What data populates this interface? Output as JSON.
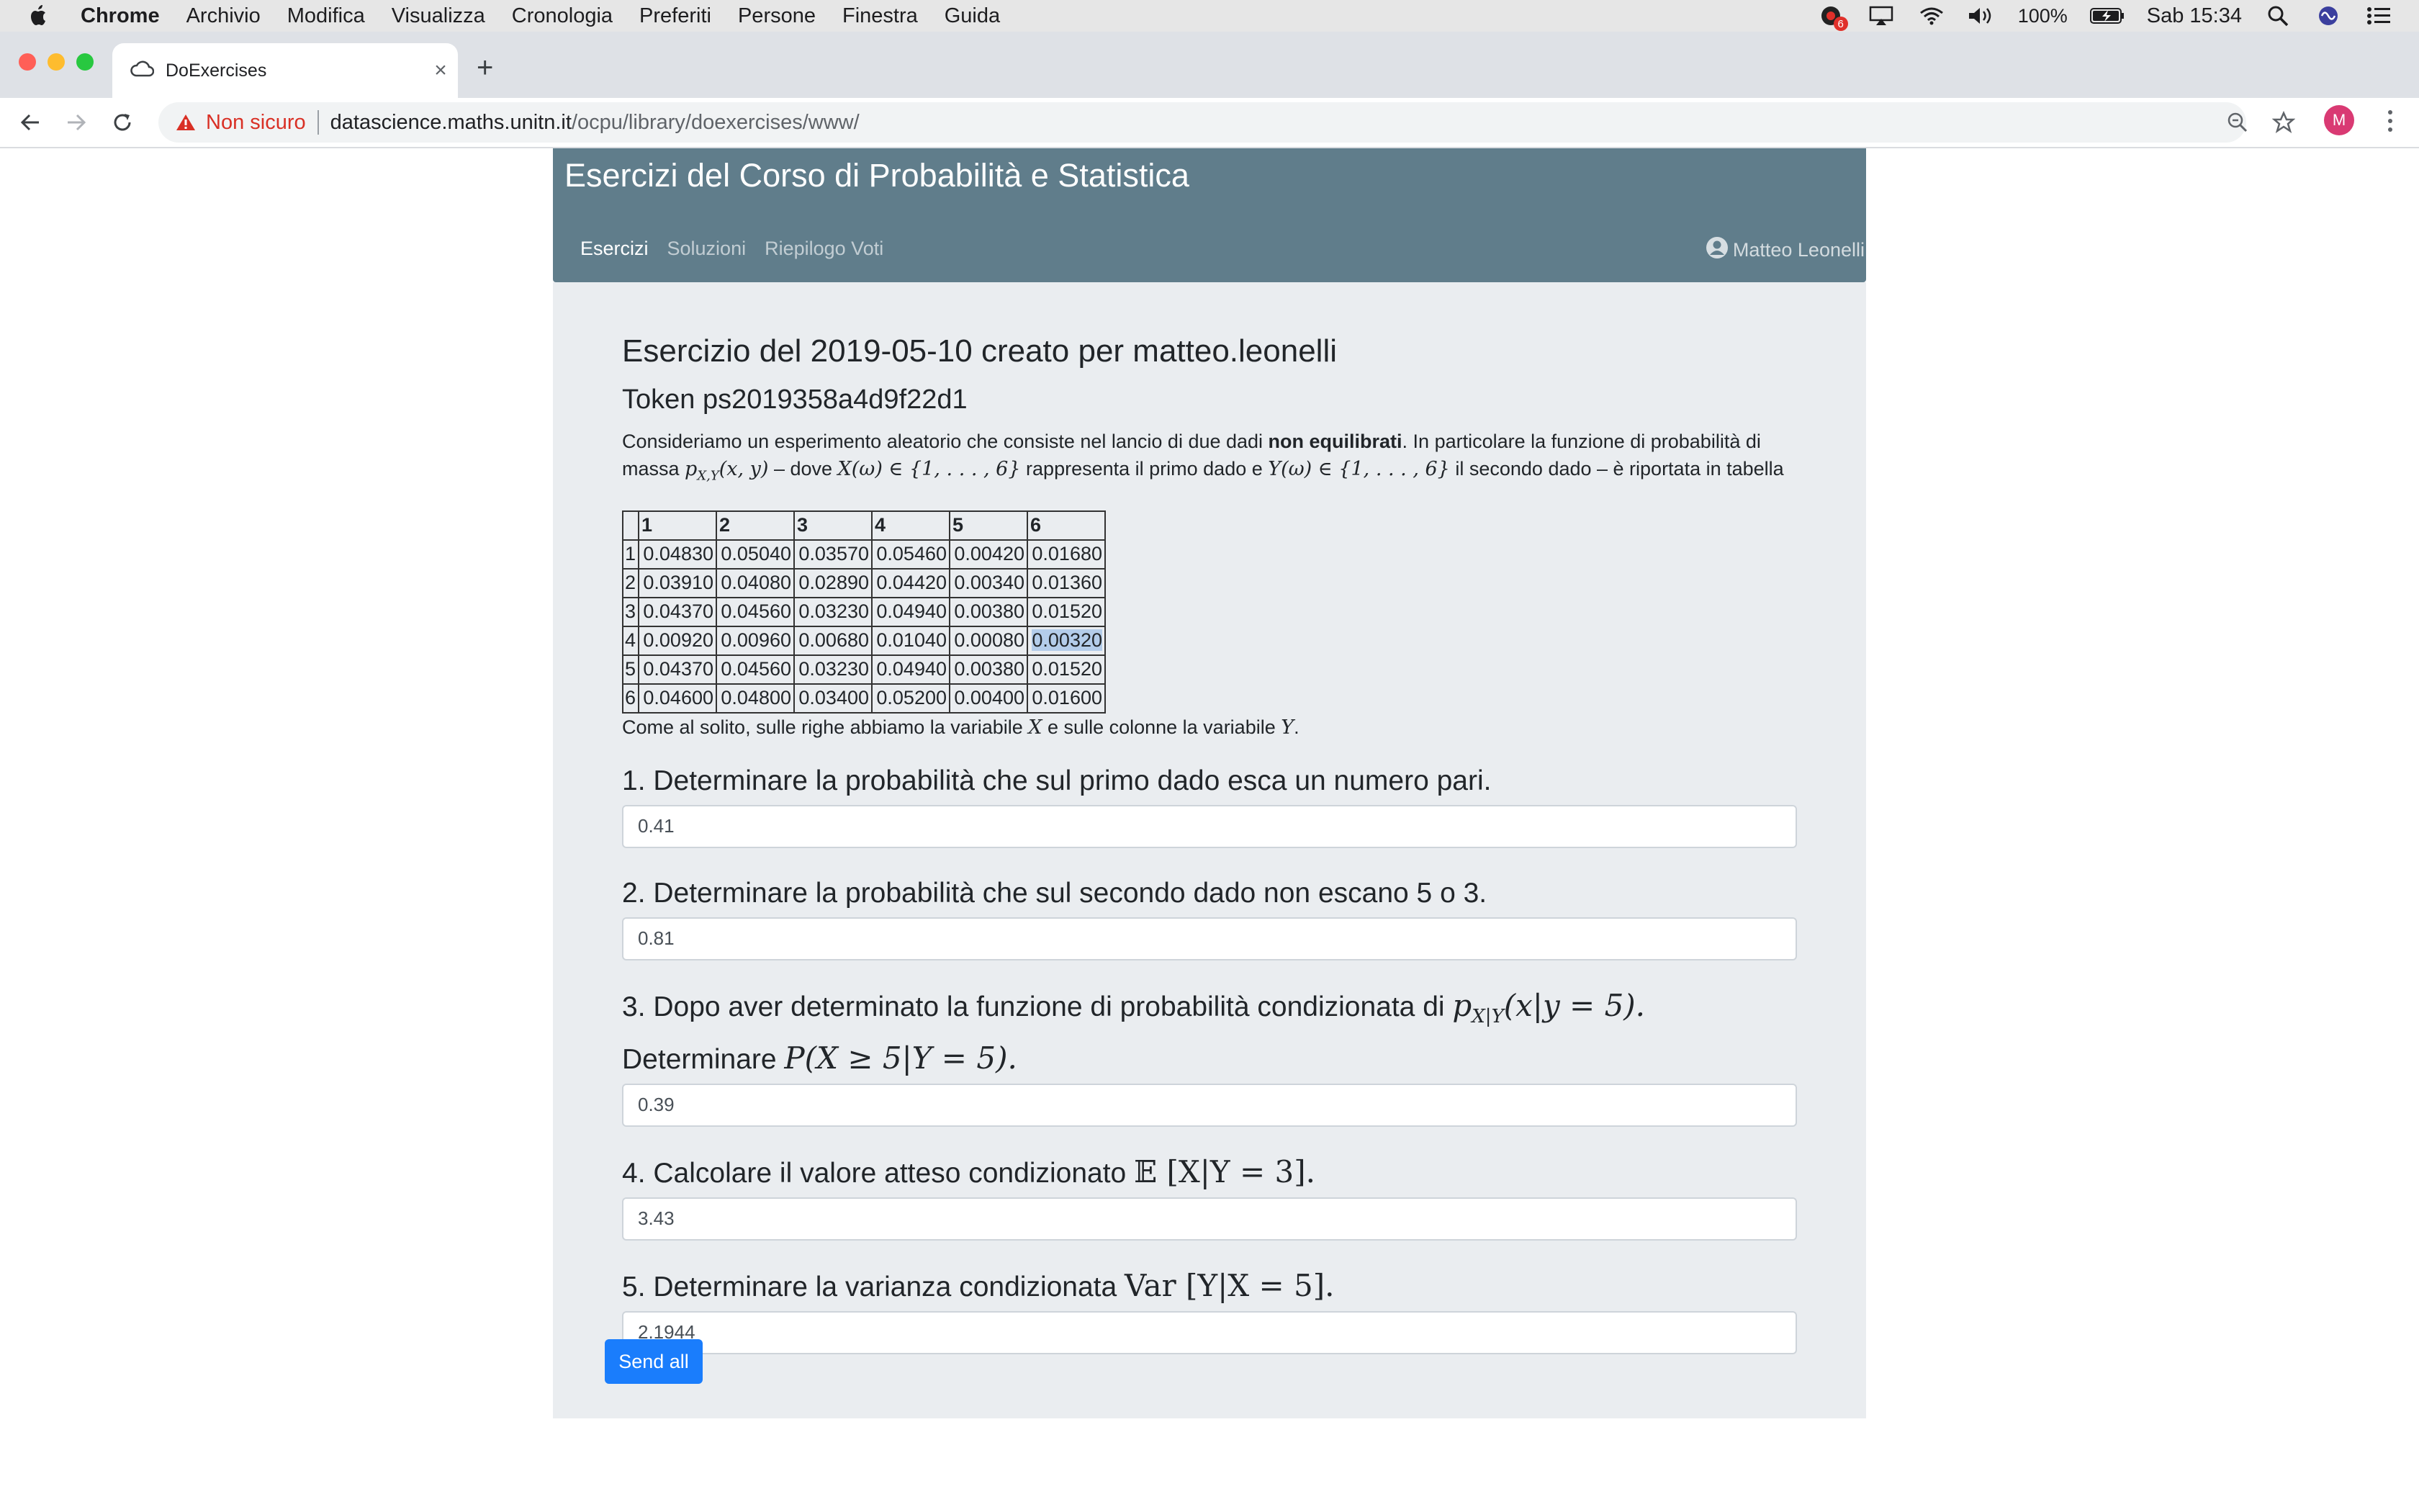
{
  "menubar": {
    "app_name": "Chrome",
    "items": [
      "Archivio",
      "Modifica",
      "Visualizza",
      "Cronologia",
      "Preferiti",
      "Persone",
      "Finestra",
      "Guida"
    ],
    "notification_count": "6",
    "battery": "100%",
    "clock": "Sab 15:34"
  },
  "browser": {
    "tab_title": "DoExercises",
    "security_label": "Non sicuro",
    "url_host": "datascience.maths.unitn.it",
    "url_path": "/ocpu/library/doexercises/www/",
    "profile_initial": "M"
  },
  "header": {
    "title": "Esercizi del Corso di Probabilità e Statistica",
    "nav": [
      "Esercizi",
      "Soluzioni",
      "Riepilogo Voti"
    ],
    "user_name": "Matteo Leonelli"
  },
  "exercise": {
    "heading": "Esercizio del 2019-05-10 creato per matteo.leonelli",
    "token": "Token ps2019358a4d9f22d1",
    "intro_1": "Consideriamo un esperimento aleatorio che consiste nel lancio di due dadi ",
    "intro_bold": "non equilibrati",
    "intro_2": ". In particolare la funzione di probabilità di massa ",
    "intro_math_pmf": "p",
    "intro_math_pmf_sub": "X,Y",
    "intro_math_pmf_args": "(x, y)",
    "intro_3": " – dove ",
    "intro_math_x": "X(ω) ∈ {1, . . . , 6}",
    "intro_4": " rappresenta il primo dado e ",
    "intro_math_y": "Y(ω) ∈ {1, . . . , 6}",
    "intro_5": " il secondo dado – è riportata in tabella",
    "table_headers": [
      "1",
      "2",
      "3",
      "4",
      "5",
      "6"
    ],
    "table_rows": [
      {
        "label": "1",
        "values": [
          "0.04830",
          "0.05040",
          "0.03570",
          "0.05460",
          "0.00420",
          "0.01680"
        ]
      },
      {
        "label": "2",
        "values": [
          "0.03910",
          "0.04080",
          "0.02890",
          "0.04420",
          "0.00340",
          "0.01360"
        ]
      },
      {
        "label": "3",
        "values": [
          "0.04370",
          "0.04560",
          "0.03230",
          "0.04940",
          "0.00380",
          "0.01520"
        ]
      },
      {
        "label": "4",
        "values": [
          "0.00920",
          "0.00960",
          "0.00680",
          "0.01040",
          "0.00080",
          "0.00320"
        ]
      },
      {
        "label": "5",
        "values": [
          "0.04370",
          "0.04560",
          "0.03230",
          "0.04940",
          "0.00380",
          "0.01520"
        ]
      },
      {
        "label": "6",
        "values": [
          "0.04600",
          "0.04800",
          "0.03400",
          "0.05200",
          "0.00400",
          "0.01600"
        ]
      }
    ],
    "after_1": "Come al solito, sulle righe abbiamo la variabile ",
    "after_x": "X",
    "after_2": " e sulle colonne la variabile ",
    "after_y": "Y",
    "after_3": "."
  },
  "questions": [
    {
      "text": "1. Determinare la probabilità che sul primo dado esca un numero pari.",
      "answer": "0.41"
    },
    {
      "text": "2. Determinare la probabilità che sul secondo dado non escano 5 o 3.",
      "answer": "0.81"
    },
    {
      "text_1": "3. Dopo aver determinato la funzione di probabilità condizionata di ",
      "math_1": "p",
      "math_1_sub": "X|Y",
      "math_1_args": "(x|y = 5).",
      "text_2": "Determinare ",
      "math_2": "P(X ≥ 5|Y = 5).",
      "answer": "0.39"
    },
    {
      "text_1": "4. Calcolare il valore atteso condizionato ",
      "math": "𝔼 [X|Y = 3].",
      "answer": "3.43"
    },
    {
      "text_1": "5. Determinare la varianza condizionata ",
      "math": "Var [Y|X = 5].",
      "answer": "2.1944"
    }
  ],
  "send_label": "Send all"
}
